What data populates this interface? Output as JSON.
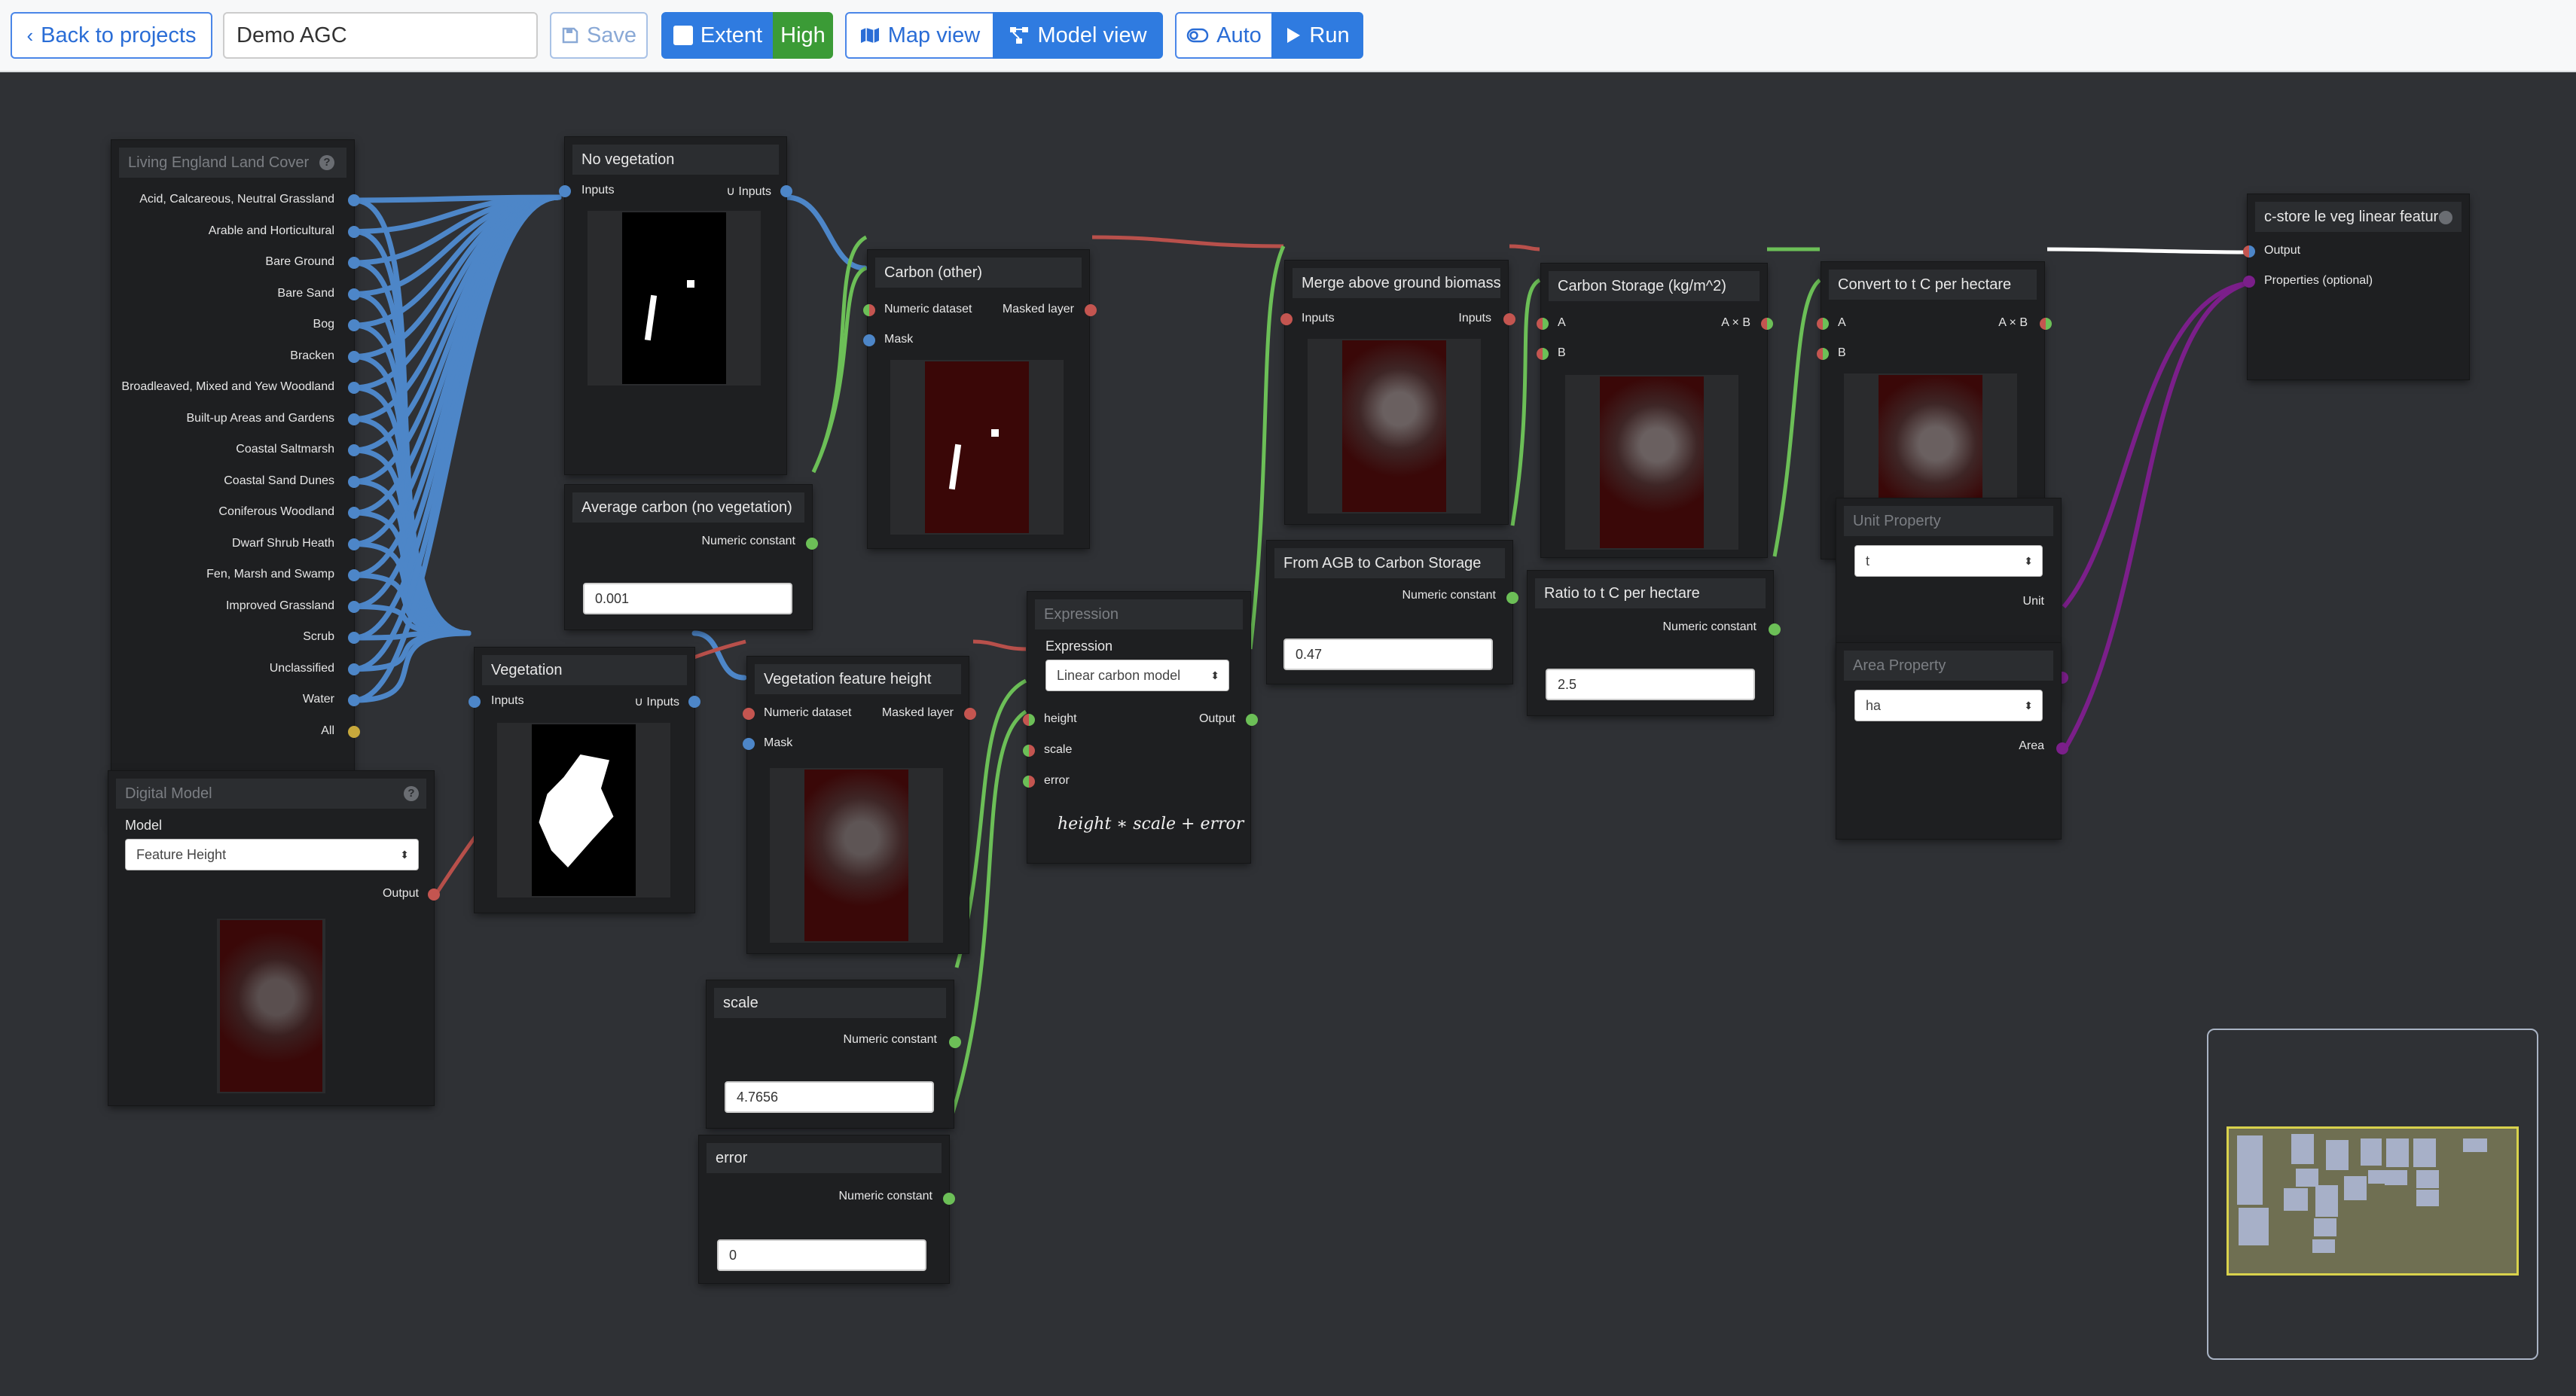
{
  "toolbar": {
    "back_label": "Back to projects",
    "project_name": "Demo AGC",
    "save_label": "Save",
    "extent_label": "Extent",
    "quality_label": "High",
    "map_view_label": "Map view",
    "model_view_label": "Model view",
    "auto_label": "Auto",
    "run_label": "Run"
  },
  "nodes": {
    "land_cover": {
      "title": "Living England Land Cover",
      "outputs": [
        "Acid, Calcareous, Neutral Grassland",
        "Arable and Horticultural",
        "Bare Ground",
        "Bare Sand",
        "Bog",
        "Bracken",
        "Broadleaved, Mixed and Yew Woodland",
        "Built-up Areas and Gardens",
        "Coastal Saltmarsh",
        "Coastal Sand Dunes",
        "Coniferous Woodland",
        "Dwarf Shrub Heath",
        "Fen, Marsh and Swamp",
        "Improved Grassland",
        "Scrub",
        "Unclassified",
        "Water",
        "All"
      ]
    },
    "digital_model": {
      "title": "Digital Model",
      "field_label": "Model",
      "model_value": "Feature Height",
      "output_label": "Output"
    },
    "no_vegetation": {
      "title": "No vegetation",
      "input_label": "Inputs",
      "output_label": "∪ Inputs"
    },
    "avg_carbon": {
      "title": "Average carbon (no vegetation)",
      "output_label": "Numeric constant",
      "value": "0.001"
    },
    "vegetation": {
      "title": "Vegetation",
      "input_label": "Inputs",
      "output_label": "∪ Inputs"
    },
    "carbon_other": {
      "title": "Carbon (other)",
      "input1": "Numeric dataset",
      "input2": "Mask",
      "output_label": "Masked layer"
    },
    "veg_height": {
      "title": "Vegetation feature height",
      "input1": "Numeric dataset",
      "input2": "Mask",
      "output_label": "Masked layer"
    },
    "scale": {
      "title": "scale",
      "output_label": "Numeric constant",
      "value": "4.7656"
    },
    "error": {
      "title": "error",
      "output_label": "Numeric constant",
      "value": "0"
    },
    "expression": {
      "title": "Expression",
      "field_label": "Expression",
      "select_value": "Linear carbon model",
      "inputs": [
        "height",
        "scale",
        "error"
      ],
      "output_label": "Output",
      "formula": "height ∗ scale + error"
    },
    "merge_agb": {
      "title": "Merge above ground biomass",
      "input_label": "Inputs",
      "output_label": "Inputs"
    },
    "agb_to_carbon": {
      "title": "From AGB to Carbon Storage",
      "output_label": "Numeric constant",
      "value": "0.47"
    },
    "carbon_storage": {
      "title": "Carbon Storage (kg/m^2)",
      "input_a": "A",
      "input_b": "B",
      "output_label": "A × B"
    },
    "ratio": {
      "title": "Ratio to t C per hectare",
      "output_label": "Numeric constant",
      "value": "2.5"
    },
    "convert": {
      "title": "Convert to t C per hectare",
      "input_a": "A",
      "input_b": "B",
      "output_label": "A × B"
    },
    "unit_property": {
      "title": "Unit Property",
      "select_value": "t",
      "output_label": "Unit"
    },
    "area_property": {
      "title": "Area Property",
      "select_value": "ha",
      "output_label": "Area"
    },
    "output_node": {
      "title": "c-store le veg linear feature",
      "input1": "Output",
      "input2": "Properties (optional)"
    }
  },
  "colors": {
    "blue_wire": "#4d86c8",
    "green_wire": "#6cbf57",
    "red_wire": "#b8504b",
    "purple_wire": "#7b1f8a",
    "white_wire": "#ffffff",
    "all_port": "#c8a93c",
    "high_badge": "#3b9b36",
    "primary": "#2f7be0"
  },
  "icons": [
    "chevron-left-icon",
    "save-icon",
    "square-icon",
    "map-icon",
    "model-icon",
    "toggle-icon",
    "play-icon",
    "help-icon",
    "settings-icon",
    "select-arrows-icon"
  ]
}
